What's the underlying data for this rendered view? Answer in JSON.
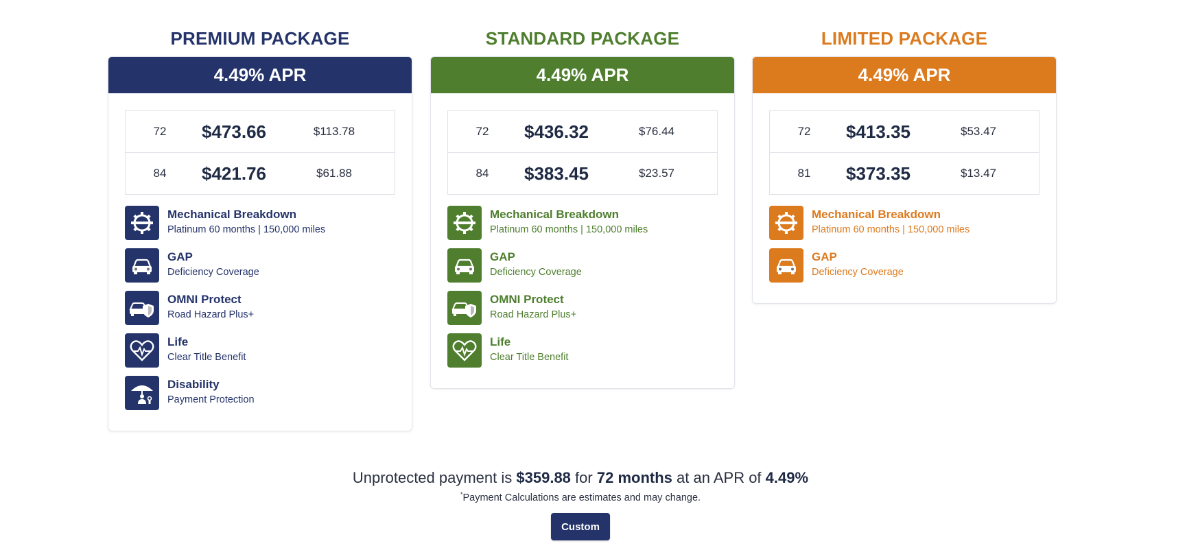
{
  "packages": [
    {
      "title": "PREMIUM PACKAGE",
      "color": "#24336a",
      "apr": "4.49% APR",
      "terms": [
        {
          "months": "72",
          "payment": "$473.66",
          "difference": "$113.78"
        },
        {
          "months": "84",
          "payment": "$421.76",
          "difference": "$61.88"
        }
      ],
      "features": [
        {
          "icon": "mechanical-breakdown-icon",
          "name": "Mechanical Breakdown",
          "detail": "Platinum 60 months | 150,000 miles"
        },
        {
          "icon": "car-icon",
          "name": "GAP",
          "detail": "Deficiency Coverage"
        },
        {
          "icon": "car-shield-icon",
          "name": "OMNI Protect",
          "detail": "Road Hazard Plus+"
        },
        {
          "icon": "heart-pulse-icon",
          "name": "Life",
          "detail": "Clear Title Benefit"
        },
        {
          "icon": "umbrella-person-icon",
          "name": "Disability",
          "detail": "Payment Protection"
        }
      ]
    },
    {
      "title": "STANDARD PACKAGE",
      "color": "#4e7e2e",
      "apr": "4.49% APR",
      "terms": [
        {
          "months": "72",
          "payment": "$436.32",
          "difference": "$76.44"
        },
        {
          "months": "84",
          "payment": "$383.45",
          "difference": "$23.57"
        }
      ],
      "features": [
        {
          "icon": "mechanical-breakdown-icon",
          "name": "Mechanical Breakdown",
          "detail": "Platinum 60 months | 150,000 miles"
        },
        {
          "icon": "car-icon",
          "name": "GAP",
          "detail": "Deficiency Coverage"
        },
        {
          "icon": "car-shield-icon",
          "name": "OMNI Protect",
          "detail": "Road Hazard Plus+"
        },
        {
          "icon": "heart-pulse-icon",
          "name": "Life",
          "detail": "Clear Title Benefit"
        }
      ]
    },
    {
      "title": "LIMITED PACKAGE",
      "color": "#dc7a1e",
      "apr": "4.49% APR",
      "terms": [
        {
          "months": "72",
          "payment": "$413.35",
          "difference": "$53.47"
        },
        {
          "months": "81",
          "payment": "$373.35",
          "difference": "$13.47"
        }
      ],
      "features": [
        {
          "icon": "mechanical-breakdown-icon",
          "name": "Mechanical Breakdown",
          "detail": "Platinum 60 months | 150,000 miles"
        },
        {
          "icon": "car-icon",
          "name": "GAP",
          "detail": "Deficiency Coverage"
        }
      ]
    }
  ],
  "summary": {
    "prefix": "Unprotected payment is",
    "payment": "$359.88",
    "for_word": "for",
    "term": "72 months",
    "apr_text": "at an APR of",
    "apr": "4.49%"
  },
  "disclaimer": {
    "mark": "*",
    "text": "Payment Calculations are estimates and may change."
  },
  "custom_button": "Custom"
}
